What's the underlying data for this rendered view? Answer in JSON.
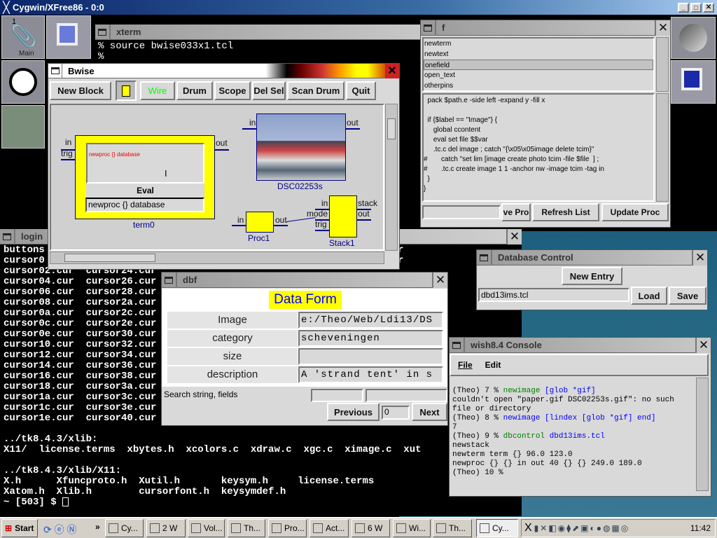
{
  "screen_title": "Cygwin/XFree86 - 0:0",
  "dock_left": {
    "pager_number": "1",
    "pager_label": "Main"
  },
  "xterm": {
    "title": "xterm",
    "lines": [
      "% source bwise033x1.tcl",
      "%"
    ]
  },
  "bwise": {
    "title": "Bwise",
    "toolbar": {
      "new_block": "New Block",
      "wire": "Wire",
      "drum": "Drum",
      "scope": "Scope",
      "del_sel": "Del Sel",
      "scan_drum": "Scan Drum",
      "quit": "Quit"
    },
    "term": {
      "name": "term0",
      "display_text": "newproc {} database",
      "eval_label": "Eval",
      "entry_value": "newproc {} database",
      "pins": {
        "in": "in",
        "trig": "trig",
        "out": "out"
      }
    },
    "image_block": {
      "name": "DSC02253s",
      "pins": {
        "in": "in",
        "out": "out"
      }
    },
    "proc": {
      "name": "Proc1",
      "pins": {
        "in": "in",
        "out": "out"
      }
    },
    "stack": {
      "name": "Stack1",
      "pins": {
        "in": "in",
        "mode": "mode",
        "trig": "trig",
        "stack": "stack",
        "out": "out"
      }
    },
    "colors": {
      "block_fill": "#ffff00",
      "block_border": "#00008b",
      "wire_label": "#00ff00"
    }
  },
  "login": {
    "title": "login",
    "lines": [
      "buttons                                                        6.cur",
      "cursor0                                                        8.cur",
      "cursor02.cur  cursor24.cur",
      "cursor04.cur  cursor26.cur",
      "cursor06.cur  cursor28.cur",
      "cursor08.cur  cursor2a.cur",
      "cursor0a.cur  cursor2c.cur",
      "cursor0c.cur  cursor2e.cur",
      "cursor0e.cur  cursor30.cur",
      "cursor10.cur  cursor32.cur",
      "cursor12.cur  cursor34.cur",
      "cursor14.cur  cursor36.cur",
      "cursor16.cur  cursor38.cur",
      "cursor18.cur  cursor3a.cur",
      "cursor1a.cur  cursor3c.cur",
      "cursor1c.cur  cursor3e.cur",
      "cursor1e.cur  cursor40.cur",
      "",
      "../tk8.4.3/xlib:",
      "X11/  license.terms  xbytes.h  xcolors.c  xdraw.c  xgc.c  ximage.c  xut",
      "",
      "../tk8.4.3/xlib/X11:",
      "X.h      Xfuncproto.h  Xutil.h       keysym.h     license.terms",
      "Xatom.h  Xlib.h        cursorfont.h  keysymdef.h",
      "~ [503] $ "
    ]
  },
  "f": {
    "title": "f",
    "list": [
      "newterm",
      "newtext",
      "onefield",
      "open_text",
      "otherpins"
    ],
    "selected": "onefield",
    "code": [
      "  pack $path.e -side left -expand y -fill x",
      "",
      "  if {$label == \"Image\"} {",
      "     global ccontent",
      "     eval set file $$var",
      "     .tc.c del image ; catch \"{\\x05\\x05image delete tcim}\"",
      "#       catch \"set lim [image create photo tcim -file $file  ] ;",
      "#       .tc.c create image 1 1 -anchor nw -image tcim -tag in",
      "  }",
      "}"
    ],
    "entry_value": "",
    "buttons": {
      "save": "ve Pro",
      "refresh": "Refresh List",
      "update": "Update Proc"
    }
  },
  "dbcontrol": {
    "title": "Database Control",
    "new_entry": "New Entry",
    "file_value": "dbd13ims.tcl",
    "load": "Load",
    "save": "Save"
  },
  "console": {
    "title": "wish8.4 Console",
    "menu": {
      "file": "File",
      "edit": "Edit"
    },
    "lines": [
      [
        {
          "t": "(Theo) 7 % ",
          "c": "#000"
        },
        {
          "t": "newimage ",
          "c": "#008000"
        },
        {
          "t": "[glob *gif]",
          "c": "#0000ff"
        }
      ],
      [
        {
          "t": "couldn't open \"paper.gif DSC02253s.gif\": no such",
          "c": "#000"
        }
      ],
      [
        {
          "t": "file or directory",
          "c": "#000"
        }
      ],
      [
        {
          "t": "(Theo) 8 % ",
          "c": "#000"
        },
        {
          "t": "newimage [lindex [glob *gif] end]",
          "c": "#0000ff"
        }
      ],
      [
        {
          "t": "7",
          "c": "#000"
        }
      ],
      [
        {
          "t": "(Theo) 9 % ",
          "c": "#000"
        },
        {
          "t": "dbcontrol ",
          "c": "#008000"
        },
        {
          "t": "dbd13ims.tcl",
          "c": "#0000ff"
        }
      ],
      [
        {
          "t": "newstack",
          "c": "#000"
        }
      ],
      [
        {
          "t": "newterm term {} 96.0 123.0",
          "c": "#000"
        }
      ],
      [
        {
          "t": "newproc {} {} in out 40 {} {} 249.0 189.0",
          "c": "#000"
        }
      ],
      [
        {
          "t": "(Theo) 10 %",
          "c": "#000"
        }
      ]
    ]
  },
  "dbf": {
    "title": "dbf",
    "heading": "Data Form",
    "fields": [
      {
        "label": "Image",
        "value": "e:/Theo/Web/Ldi13/DS"
      },
      {
        "label": "category",
        "value": "scheveningen"
      },
      {
        "label": "size",
        "value": ""
      },
      {
        "label": "description",
        "value": "A 'strand tent' in s"
      }
    ],
    "search_label": "Search string, fields",
    "search_value": "",
    "fields_value": "",
    "previous": "Previous",
    "index_value": "0",
    "next": "Next"
  },
  "taskbar": {
    "start": "Start",
    "overflow": "»",
    "items": [
      "Cy...",
      "2 W",
      "Vol...",
      "Th...",
      "Pro...",
      "Act...",
      "6 W",
      "Wi...",
      "Th...",
      "Cy..."
    ],
    "active_index": 9,
    "clock": "11:42"
  }
}
